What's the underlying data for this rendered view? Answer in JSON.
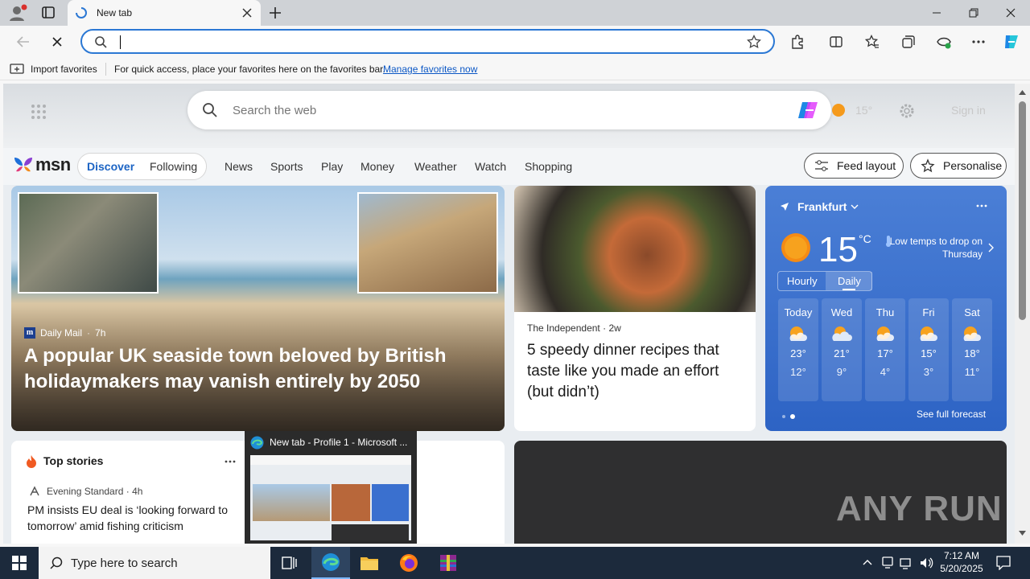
{
  "browser": {
    "tab_title": "New tab",
    "address_value": "",
    "favorites_bar": {
      "import_label": "Import favorites",
      "hint": "For quick access, place your favorites here on the favorites bar.",
      "manage_link": "Manage favorites now"
    }
  },
  "page": {
    "search_placeholder": "Search the web",
    "header_temp": "15°",
    "sign_in": "Sign in",
    "brand": "msn",
    "pill_tabs": [
      "Discover",
      "Following"
    ],
    "nav": [
      "News",
      "Sports",
      "Play",
      "Money",
      "Weather",
      "Watch",
      "Shopping"
    ],
    "feed_layout": "Feed layout",
    "personalise": "Personalise",
    "hero": {
      "source": "Daily Mail",
      "age": "7h",
      "title": "A popular UK seaside town beloved by British holidaymakers may vanish entirely by 2050"
    },
    "card2": {
      "source": "The Independent",
      "age": "2w",
      "title": "5 speedy dinner recipes that taste like you made an effort (but didn’t)"
    },
    "weather": {
      "city": "Frankfurt",
      "temp": "15",
      "unit": "°C",
      "note": "Low temps to drop on Thursday",
      "tabs": [
        "Hourly",
        "Daily"
      ],
      "days": [
        {
          "day": "Today",
          "hi": "23°",
          "lo": "12°"
        },
        {
          "day": "Wed",
          "hi": "21°",
          "lo": "9°"
        },
        {
          "day": "Thu",
          "hi": "17°",
          "lo": "4°"
        },
        {
          "day": "Fri",
          "hi": "15°",
          "lo": "3°"
        },
        {
          "day": "Sat",
          "hi": "18°",
          "lo": "11°"
        }
      ],
      "full_forecast": "See full forecast"
    },
    "top_stories": {
      "title": "Top stories",
      "source": "Evening Standard",
      "age": "4h",
      "headline": "PM insists EU deal is ‘looking forward to tomorrow’ amid fishing criticism"
    },
    "watermark": "ANY RUN"
  },
  "preview": {
    "title": "New tab - Profile 1 - Microsoft ..."
  },
  "taskbar": {
    "search_placeholder": "Type here to search",
    "time": "7:12 AM",
    "date": "5/20/2025"
  },
  "colors": {
    "accent": "#2b78d4",
    "taskbar": "#1c2a3c",
    "weather_bg": "#3a70cf"
  }
}
